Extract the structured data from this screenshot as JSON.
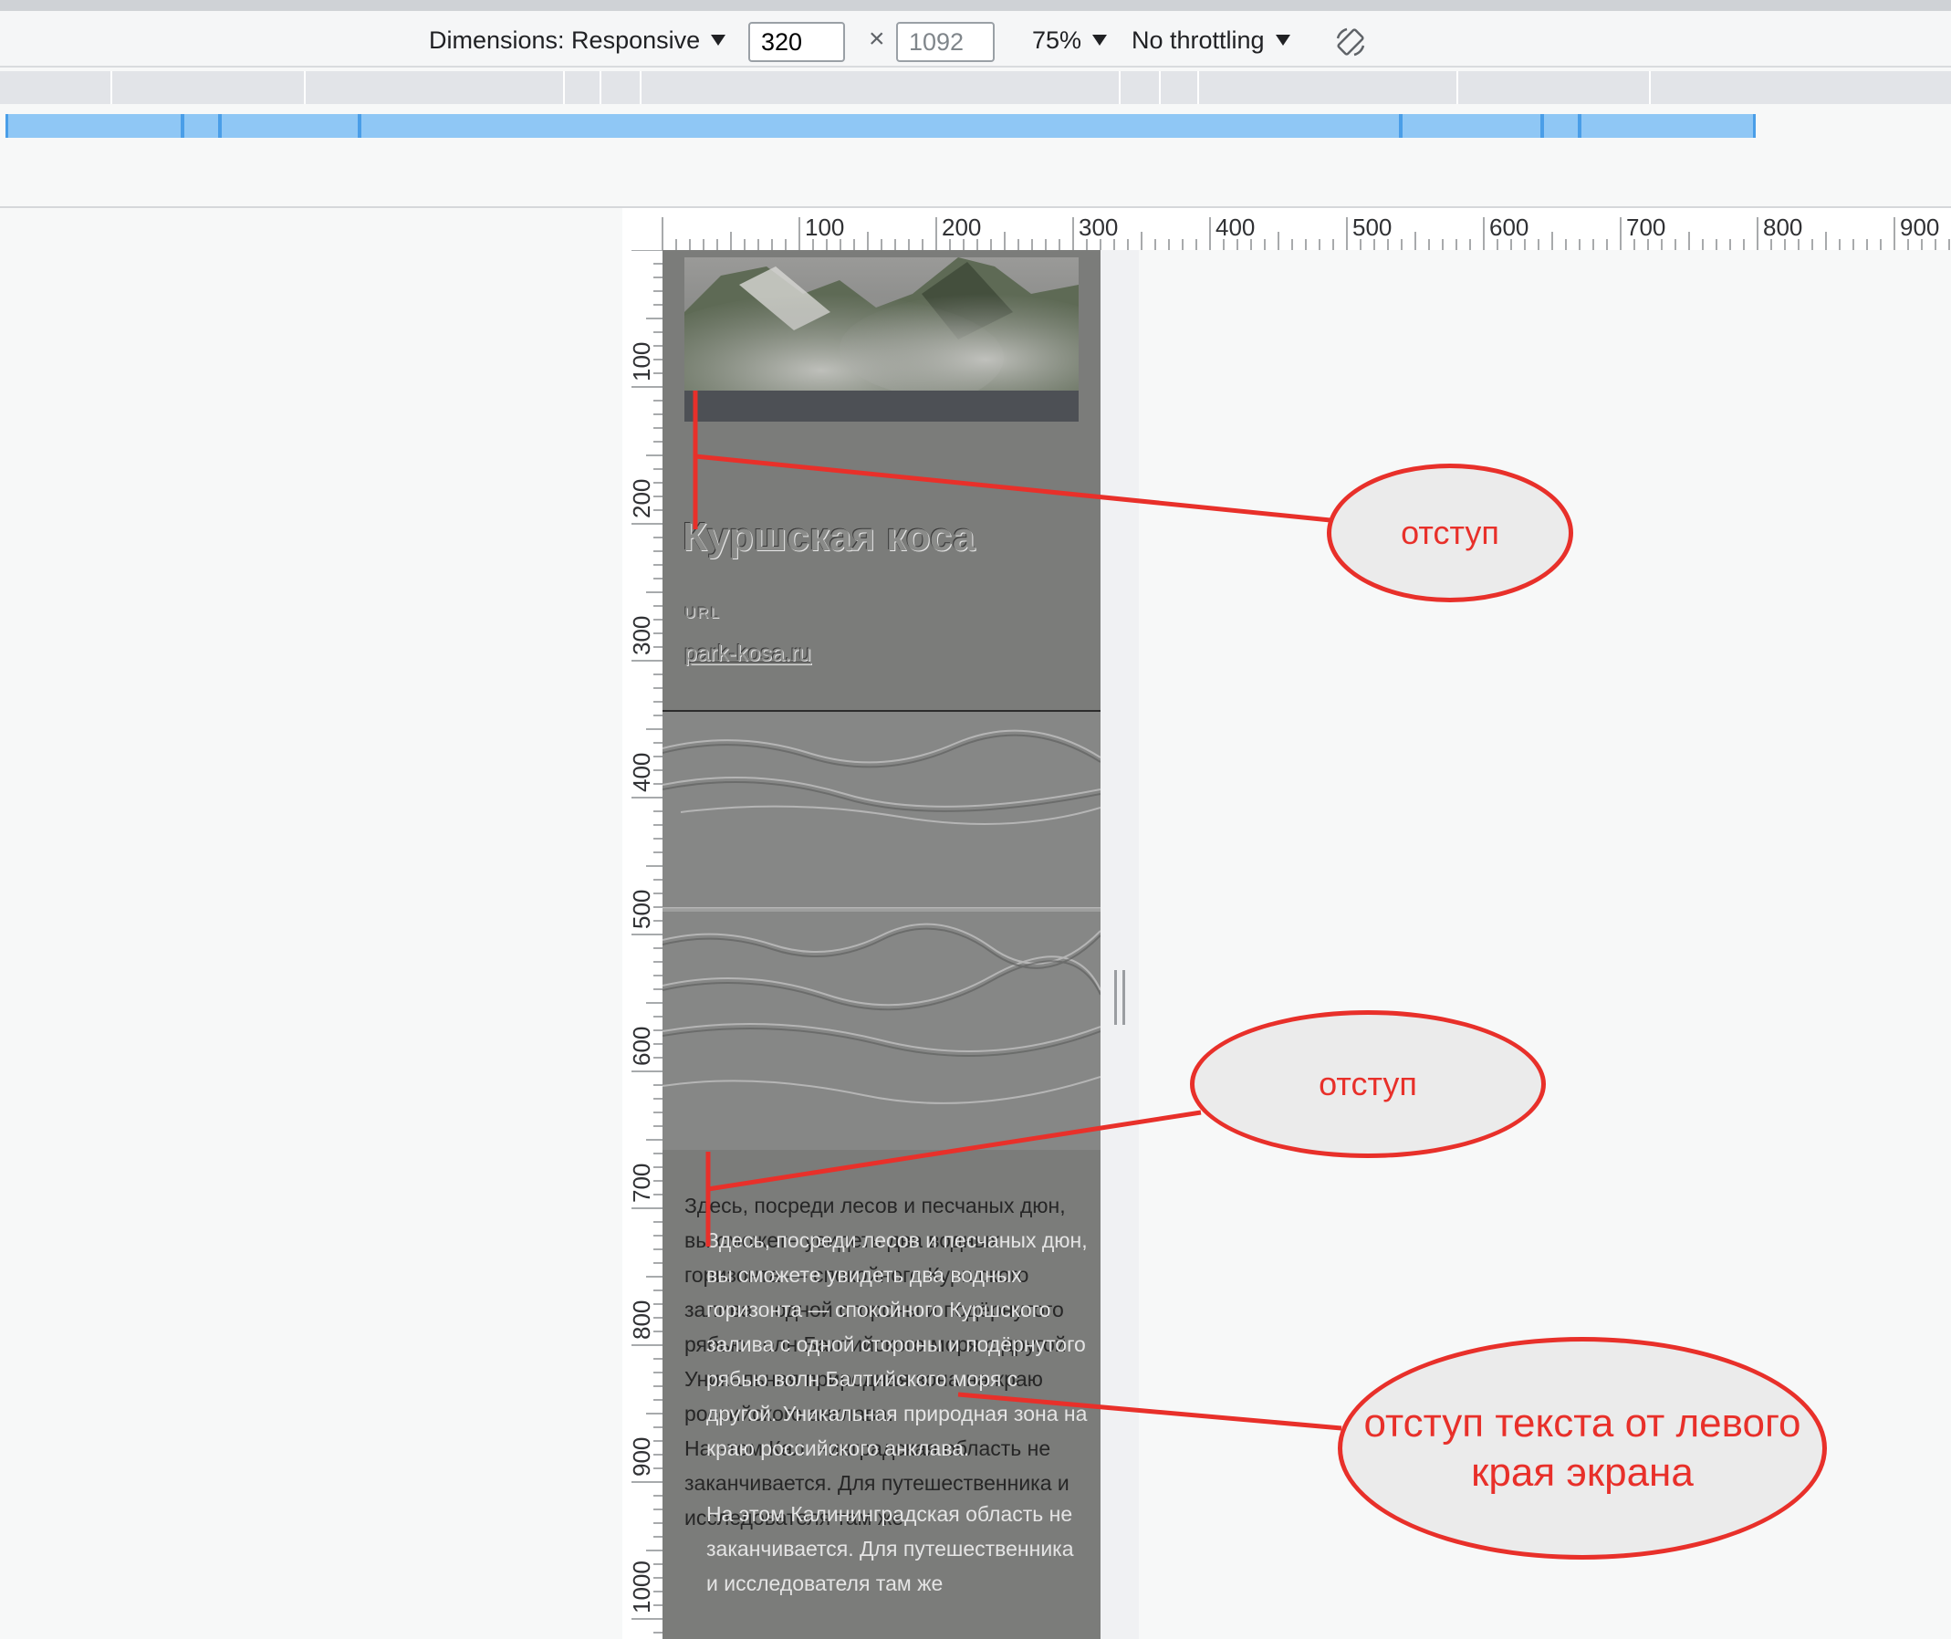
{
  "toolbar": {
    "dimensions_label": "Dimensions: Responsive",
    "width_value": "320",
    "height_placeholder": "1092",
    "times_symbol": "×",
    "zoom": "75%",
    "throttling": "No throttling",
    "rotate_icon": "rotate-icon"
  },
  "ruler": {
    "horizontal_labels": [
      "100",
      "200",
      "300",
      "400",
      "500",
      "600",
      "700",
      "800",
      "900"
    ],
    "vertical_labels": [
      "100",
      "200",
      "300",
      "400",
      "500",
      "600",
      "700",
      "800",
      "900",
      "1000"
    ]
  },
  "page": {
    "title": "Куршская коса",
    "url_label": "URL",
    "url": "park-kosa.ru",
    "paragraph1": "Здесь, посреди лесов и песчаных дюн, вы сможете увидеть два водных горизонта — спокойного Куршского залива с одной стороны и подёрнутого рябью волн Балтийского моря с другой. Уникальная природная зона на краю российского анклава.",
    "paragraph2": "На этом Калининградская область не заканчивается. Для путешественника и исследователя там же"
  },
  "annotations": {
    "callout1": "отступ",
    "callout2": "отступ",
    "callout3": "отступ текста от левого края экрана",
    "color": "#e8302a"
  }
}
